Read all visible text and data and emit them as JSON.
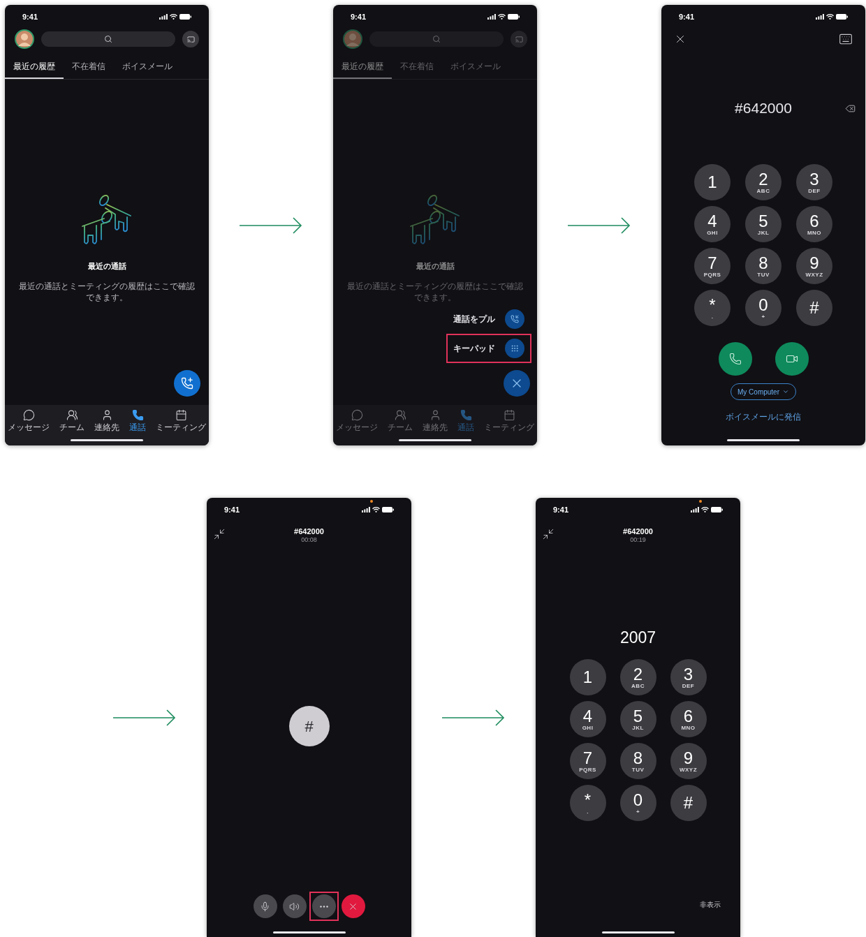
{
  "screens": [
    {
      "kind": "recent_calls",
      "status_bar": {
        "time": "9:41",
        "privacy_dot": false
      },
      "tabs": [
        {
          "label": "最近の履歴",
          "selected": true
        },
        {
          "label": "不在着信",
          "selected": false
        },
        {
          "label": "ボイスメール",
          "selected": false
        }
      ],
      "empty_state": {
        "title": "最近の通話",
        "message": "最近の通話とミーティングの履歴はここで確認できます。"
      },
      "nav": [
        {
          "kind": "messages",
          "label": "メッセージ",
          "selected": false
        },
        {
          "kind": "teams",
          "label": "チーム",
          "selected": false
        },
        {
          "kind": "contacts",
          "label": "連絡先",
          "selected": false
        },
        {
          "kind": "calls",
          "label": "通話",
          "selected": true
        },
        {
          "kind": "meetings",
          "label": "ミーティング",
          "selected": false
        }
      ]
    },
    {
      "kind": "recent_calls",
      "status_bar": {
        "time": "9:41",
        "privacy_dot": false
      },
      "tabs": [
        {
          "label": "最近の履歴",
          "selected": true
        },
        {
          "label": "不在着信",
          "selected": false
        },
        {
          "label": "ボイスメール",
          "selected": false
        }
      ],
      "empty_state": {
        "title": "最近の通話",
        "message": "最近の通話とミーティングの履歴はここで確認できます。"
      },
      "nav": [
        {
          "kind": "messages",
          "label": "メッセージ",
          "selected": false
        },
        {
          "kind": "teams",
          "label": "チーム",
          "selected": false
        },
        {
          "kind": "contacts",
          "label": "連絡先",
          "selected": false
        },
        {
          "kind": "calls",
          "label": "通話",
          "selected": true
        },
        {
          "kind": "meetings",
          "label": "ミーティング",
          "selected": false
        }
      ],
      "menu": {
        "items": [
          {
            "kind": "pull",
            "label": "通話をプル",
            "highlighted": false
          },
          {
            "kind": "keypad",
            "label": "キーパッド",
            "highlighted": true
          }
        ]
      }
    },
    {
      "kind": "dialer",
      "status_bar": {
        "time": "9:41",
        "privacy_dot": false
      },
      "number": "#642000",
      "keys": [
        {
          "digit": "1"
        },
        {
          "digit": "2",
          "letters": "ABC"
        },
        {
          "digit": "3",
          "letters": "DEF"
        },
        {
          "digit": "4",
          "letters": "GHI"
        },
        {
          "digit": "5",
          "letters": "JKL"
        },
        {
          "digit": "6",
          "letters": "MNO"
        },
        {
          "digit": "7",
          "letters": "PQRS"
        },
        {
          "digit": "8",
          "letters": "TUV"
        },
        {
          "digit": "9",
          "letters": "WXYZ"
        },
        {
          "digit": "*",
          "letters": "."
        },
        {
          "digit": "0",
          "letters": "+"
        },
        {
          "digit": "#"
        }
      ],
      "line_picker": "My Computer",
      "voicemail_link": "ボイスメールに発信"
    },
    {
      "kind": "in_call",
      "status_bar": {
        "time": "9:41",
        "privacy_dot": true
      },
      "title": "#642000",
      "timer": "00:08",
      "dtmf_key": "#",
      "controls": [
        {
          "kind": "mic",
          "highlighted": false
        },
        {
          "kind": "speaker",
          "highlighted": false
        },
        {
          "kind": "more",
          "highlighted": true
        },
        {
          "kind": "end",
          "highlighted": false
        }
      ]
    },
    {
      "kind": "in_call_keypad",
      "status_bar": {
        "time": "9:41",
        "privacy_dot": true
      },
      "title": "#642000",
      "timer": "00:19",
      "digits": "2007",
      "keys": [
        {
          "digit": "1"
        },
        {
          "digit": "2",
          "letters": "ABC"
        },
        {
          "digit": "3",
          "letters": "DEF"
        },
        {
          "digit": "4",
          "letters": "GHI"
        },
        {
          "digit": "5",
          "letters": "JKL"
        },
        {
          "digit": "6",
          "letters": "MNO"
        },
        {
          "digit": "7",
          "letters": "PQRS"
        },
        {
          "digit": "8",
          "letters": "TUV"
        },
        {
          "digit": "9",
          "letters": "WXYZ"
        },
        {
          "digit": "*",
          "letters": "."
        },
        {
          "digit": "0",
          "letters": "+"
        },
        {
          "digit": "#"
        }
      ],
      "hide_link": "非表示"
    }
  ]
}
